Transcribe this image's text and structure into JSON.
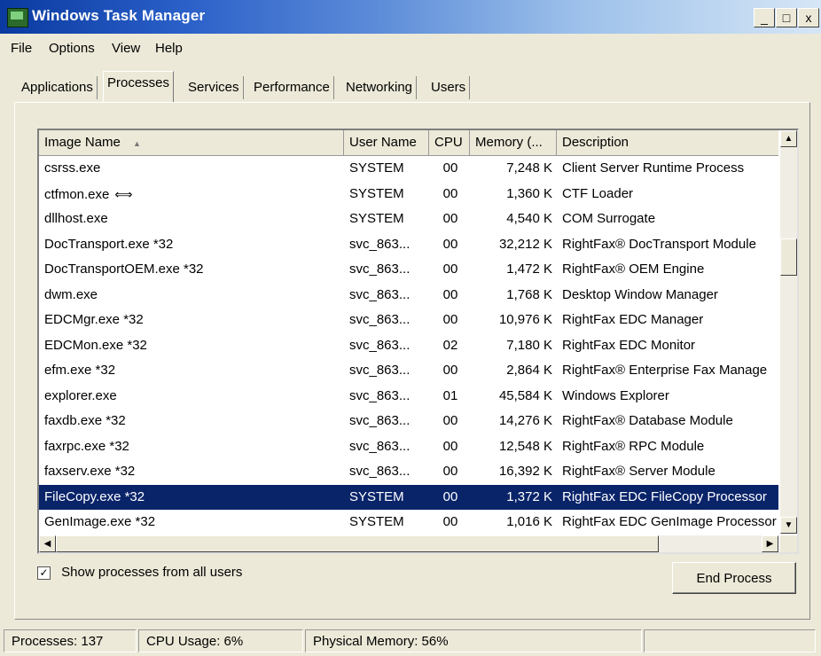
{
  "window": {
    "title": "Windows Task Manager",
    "minimize": "_",
    "maximize": "□",
    "close": "x"
  },
  "menu": [
    "File",
    "Options",
    "View",
    "Help"
  ],
  "tabs": [
    "Applications",
    "Processes",
    "Services",
    "Performance",
    "Networking",
    "Users"
  ],
  "active_tab": "Processes",
  "columns": [
    "Image Name",
    "User Name",
    "CPU",
    "Memory (...",
    "Description"
  ],
  "processes": [
    {
      "name": "csrss.exe",
      "user": "SYSTEM",
      "cpu": "00",
      "mem": "7,248 K",
      "desc": "Client Server Runtime Process"
    },
    {
      "name": "ctfmon.exe",
      "user": "SYSTEM",
      "cpu": "00",
      "mem": "1,360 K",
      "desc": "CTF Loader"
    },
    {
      "name": "dllhost.exe",
      "user": "SYSTEM",
      "cpu": "00",
      "mem": "4,540 K",
      "desc": "COM Surrogate"
    },
    {
      "name": "DocTransport.exe *32",
      "user": "svc_863...",
      "cpu": "00",
      "mem": "32,212 K",
      "desc": "RightFax® DocTransport Module"
    },
    {
      "name": "DocTransportOEM.exe *32",
      "user": "svc_863...",
      "cpu": "00",
      "mem": "1,472 K",
      "desc": "RightFax® OEM Engine"
    },
    {
      "name": "dwm.exe",
      "user": "svc_863...",
      "cpu": "00",
      "mem": "1,768 K",
      "desc": "Desktop Window Manager"
    },
    {
      "name": "EDCMgr.exe *32",
      "user": "svc_863...",
      "cpu": "00",
      "mem": "10,976 K",
      "desc": "RightFax EDC Manager"
    },
    {
      "name": "EDCMon.exe *32",
      "user": "svc_863...",
      "cpu": "02",
      "mem": "7,180 K",
      "desc": "RightFax EDC Monitor"
    },
    {
      "name": "efm.exe *32",
      "user": "svc_863...",
      "cpu": "00",
      "mem": "2,864 K",
      "desc": "RightFax® Enterprise Fax Manage"
    },
    {
      "name": "explorer.exe",
      "user": "svc_863...",
      "cpu": "01",
      "mem": "45,584 K",
      "desc": "Windows Explorer"
    },
    {
      "name": "faxdb.exe *32",
      "user": "svc_863...",
      "cpu": "00",
      "mem": "14,276 K",
      "desc": "RightFax® Database Module"
    },
    {
      "name": "faxrpc.exe *32",
      "user": "svc_863...",
      "cpu": "00",
      "mem": "12,548 K",
      "desc": "RightFax® RPC Module"
    },
    {
      "name": "faxserv.exe *32",
      "user": "svc_863...",
      "cpu": "00",
      "mem": "16,392 K",
      "desc": "RightFax® Server Module"
    },
    {
      "name": "FileCopy.exe *32",
      "user": "SYSTEM",
      "cpu": "00",
      "mem": "1,372 K",
      "desc": "RightFax EDC FileCopy Processor",
      "selected": true
    },
    {
      "name": "GenImage.exe *32",
      "user": "SYSTEM",
      "cpu": "00",
      "mem": "1,016 K",
      "desc": "RightFax EDC GenImage Processor"
    }
  ],
  "show_all_users": {
    "label": "Show processes from all users",
    "checked": true,
    "mark": "✓"
  },
  "end_process_label": "End Process",
  "status": {
    "processes": "Processes: 137",
    "cpu": "CPU Usage: 6%",
    "memory": "Physical Memory: 56%"
  },
  "icons": {
    "sort": "▲",
    "scroll_up": "▲",
    "scroll_down": "▼",
    "scroll_left": "◀",
    "scroll_right": "▶",
    "cursor": "⟺"
  },
  "colors": {
    "selection": "#0a246a",
    "title_gradient_start": "#0a3aa0"
  }
}
